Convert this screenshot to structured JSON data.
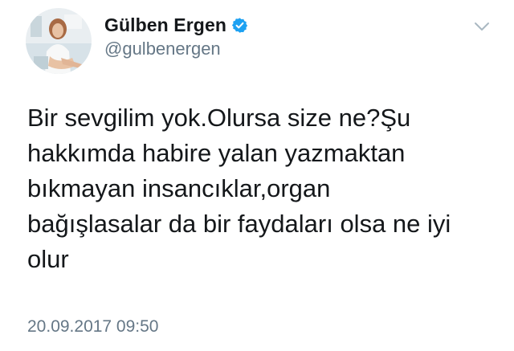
{
  "author": {
    "display_name": "Gülben Ergen",
    "handle": "@gulbenergen",
    "verified": true
  },
  "tweet": {
    "text_lines": [
      "Bir sevgilim yok.Olursa size ne?Şu",
      "hakkımda habire yalan yazmaktan",
      "bıkmayan insancıklar,organ",
      "bağışlasalar da bir faydaları olsa ne iyi",
      "olur"
    ],
    "timestamp": "20.09.2017 09:50"
  },
  "icons": {
    "verified": "verified-badge-icon",
    "menu": "chevron-down-icon",
    "avatar": "profile-photo"
  },
  "colors": {
    "verified_blue": "#1da1f2",
    "secondary_text": "#657786",
    "primary_text": "#14171a"
  }
}
